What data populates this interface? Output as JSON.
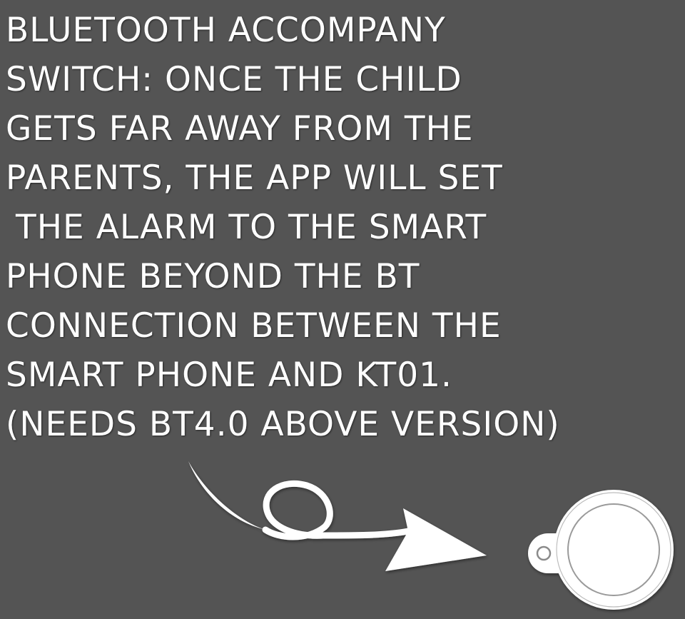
{
  "caption": {
    "lines": [
      "Bluetooth Accompany",
      "Switch: Once the child",
      "gets far away from the",
      "parents, the APP will set",
      "the alarm to the smart",
      "phone beyond the BT",
      "connection between the",
      "smart phone and KT01.",
      "(needs BT4.0 above version)"
    ]
  },
  "colors": {
    "background": "#545454",
    "foreground": "#ffffff"
  },
  "illustration": {
    "icons": [
      "looping-arrow-icon",
      "kt01-tag-icon"
    ]
  }
}
